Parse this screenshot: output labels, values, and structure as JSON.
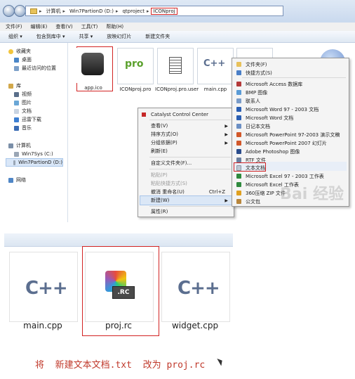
{
  "explorer": {
    "address": {
      "segments": [
        "计算机",
        "Win7PartionD (D:)",
        "qtproject",
        "ICONproj"
      ]
    },
    "menubar": [
      "文件(F)",
      "编辑(E)",
      "查看(V)",
      "工具(T)",
      "帮助(H)"
    ],
    "toolbar": [
      "组织 ▾",
      "包含到库中 ▾",
      "共享 ▾",
      "放映幻灯片",
      "新建文件夹"
    ],
    "nav": {
      "favorites": "收藏夹",
      "favorites_items": [
        "桌面",
        "最近访问的位置"
      ],
      "libraries": "库",
      "libraries_items": [
        "视频",
        "图片",
        "文档",
        "迅雷下载",
        "音乐"
      ],
      "computer": "计算机",
      "computer_items": [
        "Win7Sys (C:)",
        "Win7PartionD (D:)"
      ],
      "network": "网络"
    },
    "files": [
      {
        "name": "app.ico",
        "icon": "app-ico-icon"
      },
      {
        "name": "ICONproj.pro",
        "icon": "pro-file-icon",
        "badge": "pro"
      },
      {
        "name": "ICONproj.pro.user",
        "icon": "pro-user-file-icon"
      },
      {
        "name": "main.cpp",
        "icon": "cpp-file-icon",
        "badge": "C++"
      }
    ],
    "context_menu": {
      "items": [
        {
          "label": "Catalyst Control Center",
          "disabled": false,
          "arrow": false
        },
        {
          "label": "查看(V)",
          "disabled": false,
          "arrow": true
        },
        {
          "label": "排序方式(O)",
          "disabled": false,
          "arrow": true
        },
        {
          "label": "分组依据(P)",
          "disabled": false,
          "arrow": true
        },
        {
          "label": "刷新(E)",
          "disabled": false,
          "arrow": false
        },
        {
          "label": "自定义文件夹(F)...",
          "disabled": false,
          "arrow": false
        },
        {
          "label": "粘贴(P)",
          "disabled": true,
          "arrow": false
        },
        {
          "label": "粘贴快捷方式(S)",
          "disabled": true,
          "arrow": false
        },
        {
          "label": "撤消 重命名(U)",
          "disabled": false,
          "arrow": false,
          "shortcut": "Ctrl+Z"
        },
        {
          "label": "新建(W)",
          "disabled": false,
          "arrow": true,
          "highlighted": true
        },
        {
          "label": "属性(R)",
          "disabled": false,
          "arrow": false
        }
      ]
    },
    "new_submenu": {
      "items": [
        {
          "label": "文件夹(F)",
          "color": "#e8c15a"
        },
        {
          "label": "快捷方式(S)",
          "color": "#4a7fc7"
        },
        {
          "label": "Microsoft Access 数据库",
          "color": "#b33a3a"
        },
        {
          "label": "BMP 图像",
          "color": "#5a9bd6"
        },
        {
          "label": "联系人",
          "color": "#7a9cc9"
        },
        {
          "label": "Microsoft Word 97 - 2003 文档",
          "color": "#2b5fb3"
        },
        {
          "label": "Microsoft Word 文档",
          "color": "#2b5fb3"
        },
        {
          "label": "日记本文档",
          "color": "#6b8fc4"
        },
        {
          "label": "Microsoft PowerPoint 97-2003 演示文稿",
          "color": "#d2582a"
        },
        {
          "label": "Microsoft PowerPoint 2007 幻灯片",
          "color": "#d2582a"
        },
        {
          "label": "Adobe Photoshop 图像",
          "color": "#2a4c8c"
        },
        {
          "label": "RTF 文件",
          "color": "#6a7f9f"
        },
        {
          "label": "文本文档",
          "color": "#bfc7d2",
          "highlighted": true
        },
        {
          "label": "Microsoft Excel 97 - 2003 工作表",
          "color": "#2f8a3e"
        },
        {
          "label": "Microsoft Excel 工作表",
          "color": "#2f8a3e"
        },
        {
          "label": "360压缩 ZIP 文件",
          "color": "#e0a020"
        },
        {
          "label": "公文包",
          "color": "#b8863c"
        }
      ]
    }
  },
  "bottom": {
    "files": [
      {
        "name": "main.cpp",
        "icon": "cpp-file-icon",
        "badge": "C++"
      },
      {
        "name": "proj.rc",
        "icon": "rc-file-icon",
        "badge": ".RC"
      },
      {
        "name": "widget.cpp",
        "icon": "cpp-file-icon",
        "badge": "C++"
      }
    ],
    "instruction": "将  新建文本文档.txt  改为 proj.rc"
  },
  "watermark": "Bai 经验",
  "colors": {
    "highlight_box": "#d22323",
    "instruction_text": "#c0392b"
  }
}
